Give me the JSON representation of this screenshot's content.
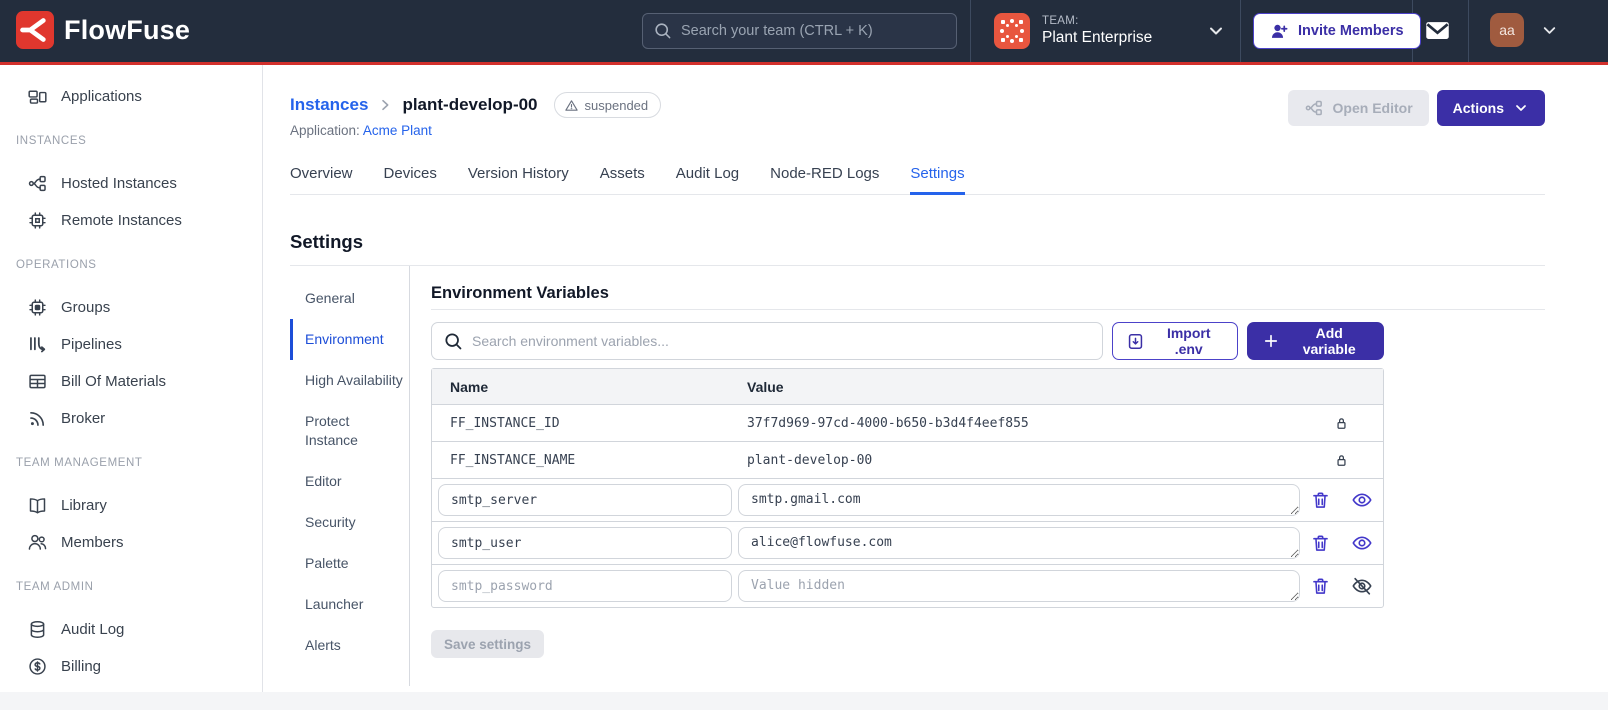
{
  "colors": {
    "header_bg": "#232d3d",
    "brand_red": "#d2302c",
    "accent_indigo": "#3b2fa6",
    "icon_indigo": "#4338ca",
    "link_blue": "#2563eb",
    "subnav_active_blue": "#1d4ed8",
    "team_avatar_orange": "#e8563f",
    "user_avatar_brown": "#a05b3f"
  },
  "header": {
    "brand": "FlowFuse",
    "search_placeholder": "Search your team (CTRL + K)",
    "team_label": "TEAM:",
    "team_name": "Plant Enterprise",
    "invite_button": "Invite Members",
    "avatar_initials": "aa"
  },
  "sidebar": {
    "applications": "Applications",
    "sections": [
      {
        "label": "INSTANCES",
        "items": [
          "Hosted Instances",
          "Remote Instances"
        ]
      },
      {
        "label": "OPERATIONS",
        "items": [
          "Groups",
          "Pipelines",
          "Bill Of Materials",
          "Broker"
        ]
      },
      {
        "label": "TEAM MANAGEMENT",
        "items": [
          "Library",
          "Members"
        ]
      },
      {
        "label": "TEAM ADMIN",
        "items": [
          "Audit Log",
          "Billing"
        ]
      }
    ]
  },
  "page": {
    "breadcrumb_parent": "Instances",
    "breadcrumb_current": "plant-develop-00",
    "status_badge": "suspended",
    "application_label": "Application:",
    "application_name": "Acme Plant",
    "open_editor_button": "Open Editor",
    "actions_button": "Actions",
    "tabs": [
      "Overview",
      "Devices",
      "Version History",
      "Assets",
      "Audit Log",
      "Node-RED Logs",
      "Settings"
    ],
    "active_tab": "Settings"
  },
  "settings": {
    "title": "Settings",
    "nav": [
      "General",
      "Environment",
      "High Availability",
      "Protect Instance",
      "Editor",
      "Security",
      "Palette",
      "Launcher",
      "Alerts"
    ],
    "active_nav": "Environment"
  },
  "environment": {
    "title": "Environment Variables",
    "search_placeholder": "Search environment variables...",
    "import_button": "Import .env",
    "add_button": "Add variable",
    "columns": {
      "name": "Name",
      "value": "Value"
    },
    "locked_rows": [
      {
        "name": "FF_INSTANCE_ID",
        "value": "37f7d969-97cd-4000-b650-b3d4f4eef855"
      },
      {
        "name": "FF_INSTANCE_NAME",
        "value": "plant-develop-00"
      }
    ],
    "editable_rows": [
      {
        "name": "smtp_server",
        "value": "smtp.gmail.com"
      },
      {
        "name": "smtp_user",
        "value": "alice@flowfuse.com"
      },
      {
        "name": "smtp_password",
        "value": "",
        "value_placeholder": "Value hidden"
      }
    ],
    "save_button": "Save settings"
  }
}
